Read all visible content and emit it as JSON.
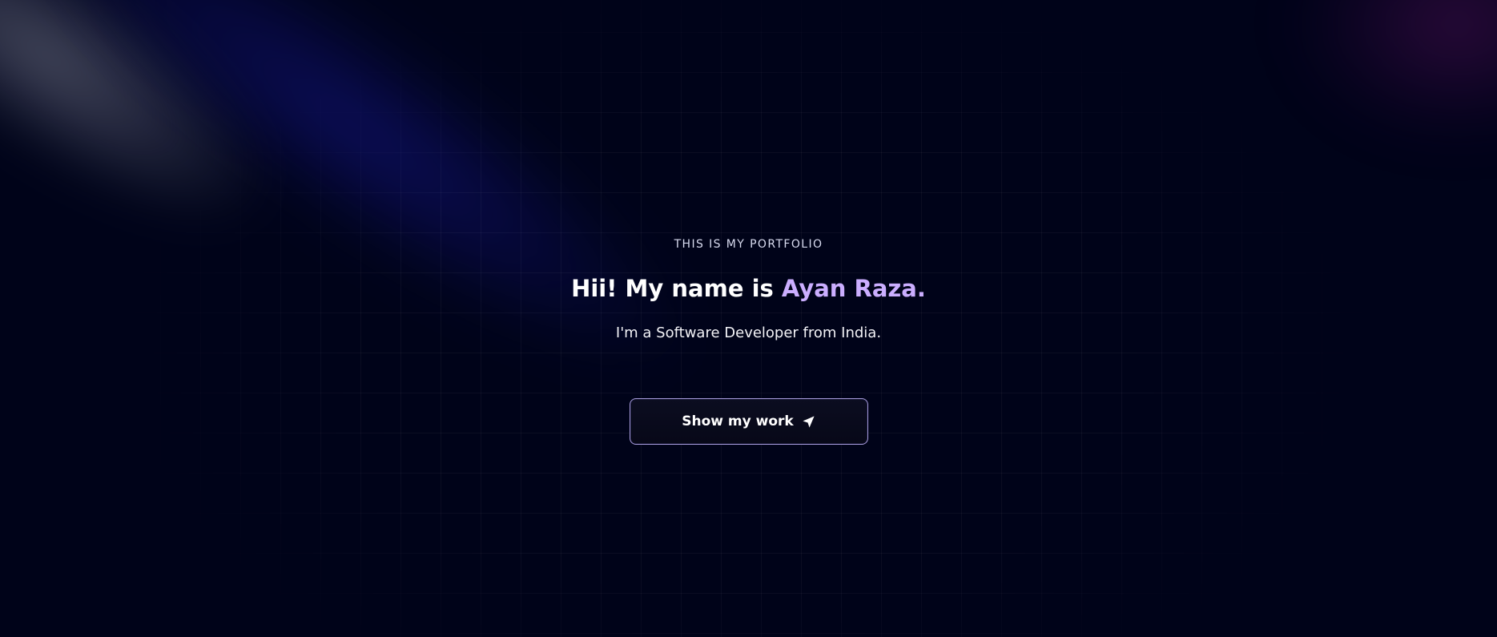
{
  "hero": {
    "eyebrow": "THIS IS MY PORTFOLIO",
    "headline_prefix": "Hii! My name is ",
    "headline_name": "Ayan Raza.",
    "tagline": "I'm a Software Developer from India.",
    "cta_label": "Show my work",
    "cta_icon": "location-arrow-icon"
  },
  "colors": {
    "background": "#000319",
    "accent_name": "#cbaeff",
    "button_border": "#a79bdc"
  }
}
